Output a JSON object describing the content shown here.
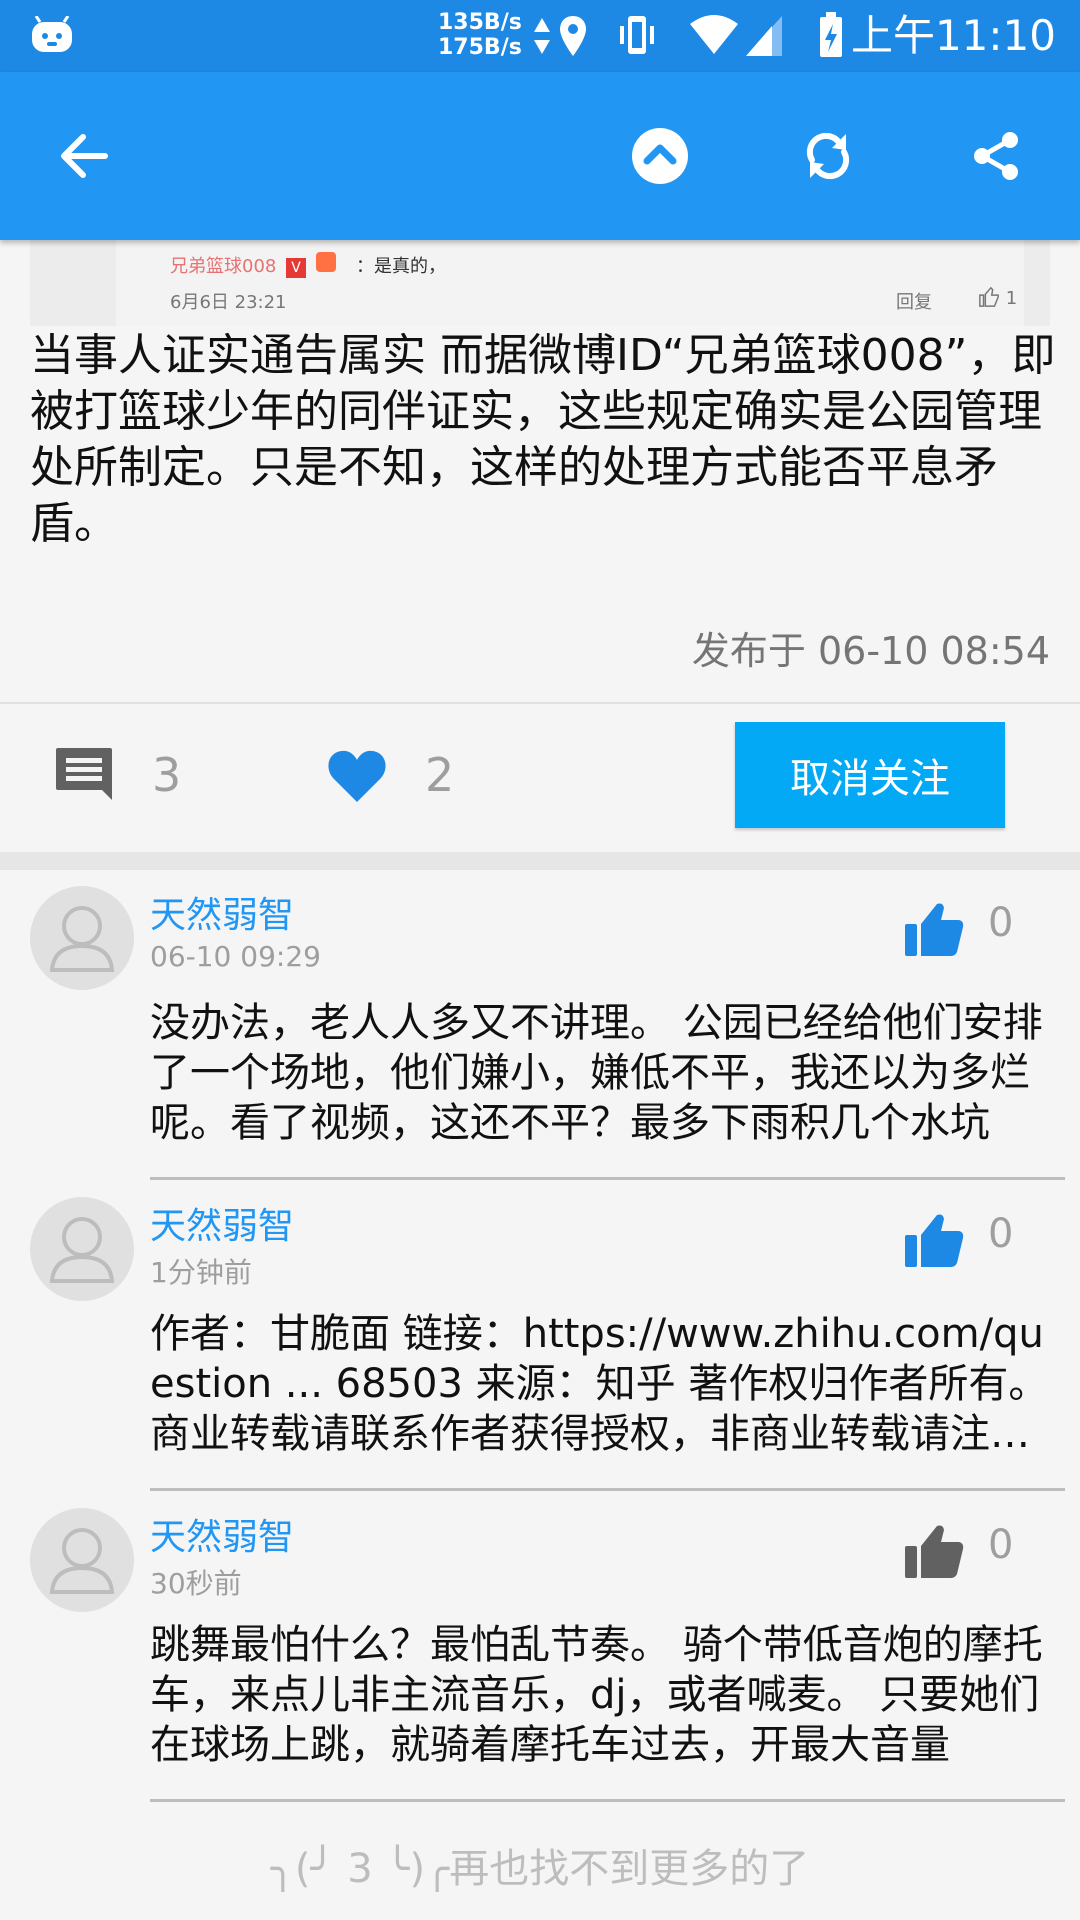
{
  "status_bar": {
    "net_up": "135B/s",
    "net_down": "175B/s",
    "time": "上午11:10"
  },
  "toolbar": {
    "back_icon": "arrow-left-icon",
    "scroll_top_icon": "chevron-up-circle-icon",
    "refresh_icon": "refresh-icon",
    "share_icon": "share-icon"
  },
  "article": {
    "image_snippet": {
      "name": "兄弟篮球008",
      "text": "：是真的，",
      "date": "6月6日 23:21",
      "reply": "回复",
      "likes": "1"
    },
    "text": "当事人证实通告属实 而据微博ID“兄弟篮球008”，即被打篮球少年的同伴证实，这些规定确实是公园管理处所制定。只是不知，这样的处理方式能否平息矛盾。",
    "published": "发布于  06-10 08:54"
  },
  "actions": {
    "comment_count": "3",
    "like_count": "2",
    "unfollow_label": "取消关注"
  },
  "comments": [
    {
      "name": "天然弱智",
      "time": "06-10 09:29",
      "likes": "0",
      "liked": true,
      "text": "没办法，老人人多又不讲理。 公园已经给他们安排了一个场地，他们嫌小，嫌低不平，我还以为多烂呢。看了视频，这还不平？最多下雨积几个水坑"
    },
    {
      "name": "天然弱智",
      "time": "1分钟前",
      "likes": "0",
      "liked": true,
      "text": "作者：甘脆面 链接：https://www.zhihu.com/question ... 68503 来源：知乎 著作权归作者所有。商业转载请联系作者获得授权，非商业转载请注明出处。"
    },
    {
      "name": "天然弱智",
      "time": "30秒前",
      "likes": "0",
      "liked": false,
      "text": "跳舞最怕什么？最怕乱节奏。 骑个带低音炮的摩托车，来点儿非主流音乐，dj，或者喊麦。 只要她们在球场上跳，就骑着摩托车过去，开最大音量"
    }
  ],
  "footer": {
    "no_more": "╮(╯ 3 ╰)╭再也找不到更多的了"
  },
  "colors": {
    "status_bar": "#1e88e5",
    "toolbar": "#2196f3",
    "accent": "#03a9f4",
    "like_active": "#1e88e5",
    "like_inactive": "#616161"
  }
}
